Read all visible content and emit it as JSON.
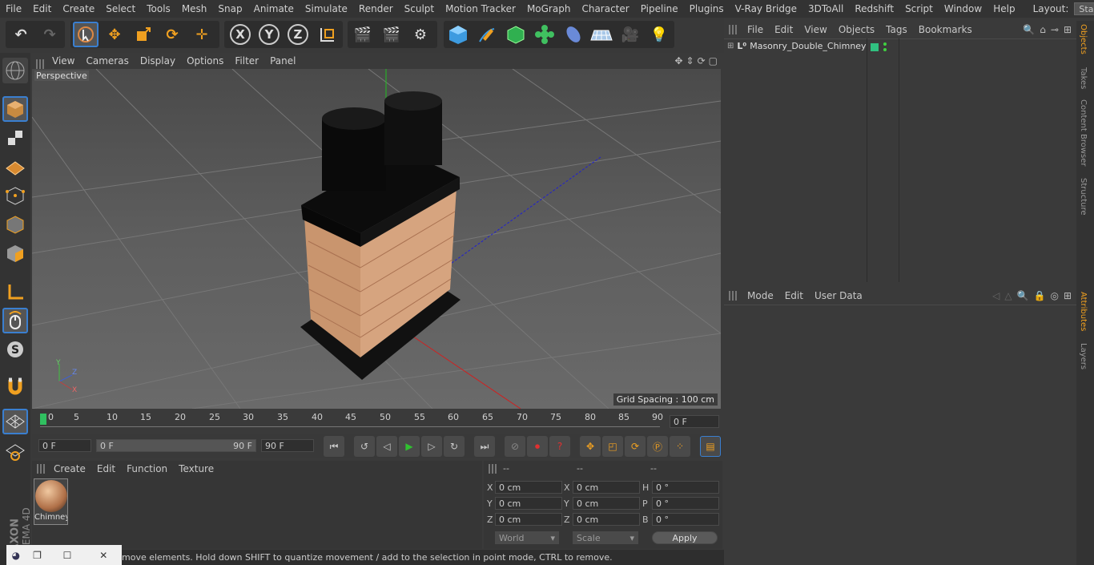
{
  "menubar": {
    "items": [
      "File",
      "Edit",
      "Create",
      "Select",
      "Tools",
      "Mesh",
      "Snap",
      "Animate",
      "Simulate",
      "Render",
      "Sculpt",
      "Motion Tracker",
      "MoGraph",
      "Character",
      "Pipeline",
      "Plugins",
      "V-Ray Bridge",
      "3DToAll",
      "Redshift",
      "Script",
      "Window",
      "Help"
    ],
    "layout_label": "Layout:",
    "layout_value": "Startup"
  },
  "toolbar": {
    "axis_x": "X",
    "axis_y": "Y",
    "axis_z": "Z"
  },
  "viewport": {
    "menu": [
      "View",
      "Cameras",
      "Display",
      "Options",
      "Filter",
      "Panel"
    ],
    "camera_label": "Perspective",
    "grid_spacing": "Grid Spacing : 100 cm",
    "axis_x": "X",
    "axis_y": "Y",
    "axis_z": "Z"
  },
  "timeline": {
    "ticks": [
      "0",
      "5",
      "10",
      "15",
      "20",
      "25",
      "30",
      "35",
      "40",
      "45",
      "50",
      "55",
      "60",
      "65",
      "70",
      "75",
      "80",
      "85",
      "90"
    ],
    "current_frame": "0 F"
  },
  "transport": {
    "start_field": "0 F",
    "range_start": "0 F",
    "range_end": "90 F",
    "end_field": "90 F"
  },
  "material_manager": {
    "menu": [
      "Create",
      "Edit",
      "Function",
      "Texture"
    ],
    "material_name": "Chimney"
  },
  "coordinates": {
    "header": [
      "--",
      "--",
      "--"
    ],
    "rows": [
      {
        "l1": "X",
        "v1": "0 cm",
        "l2": "X",
        "v2": "0 cm",
        "l3": "H",
        "v3": "0 °"
      },
      {
        "l1": "Y",
        "v1": "0 cm",
        "l2": "Y",
        "v2": "0 cm",
        "l3": "P",
        "v3": "0 °"
      },
      {
        "l1": "Z",
        "v1": "0 cm",
        "l2": "Z",
        "v2": "0 cm",
        "l3": "B",
        "v3": "0 °"
      }
    ],
    "world": "World",
    "scale": "Scale",
    "apply": "Apply"
  },
  "status": {
    "text": "move elements. Hold down SHIFT to quantize movement / add to the selection in point mode, CTRL to remove."
  },
  "objects_panel": {
    "menu": [
      "File",
      "Edit",
      "View",
      "Objects",
      "Tags",
      "Bookmarks"
    ],
    "object_name": "Masonry_Double_Chimney"
  },
  "attributes_panel": {
    "menu": [
      "Mode",
      "Edit",
      "User Data"
    ]
  },
  "side_tabs": [
    "Objects",
    "Takes",
    "Content Browser",
    "Structure",
    "Attributes",
    "Layers"
  ],
  "brand": {
    "maxon": "MAXON",
    "product": "CINEMA 4D"
  },
  "colors": {
    "accent": "#f0a020",
    "select_blue": "#3a7fd0",
    "brick": "#d2a07a",
    "play_green": "#30c030"
  }
}
